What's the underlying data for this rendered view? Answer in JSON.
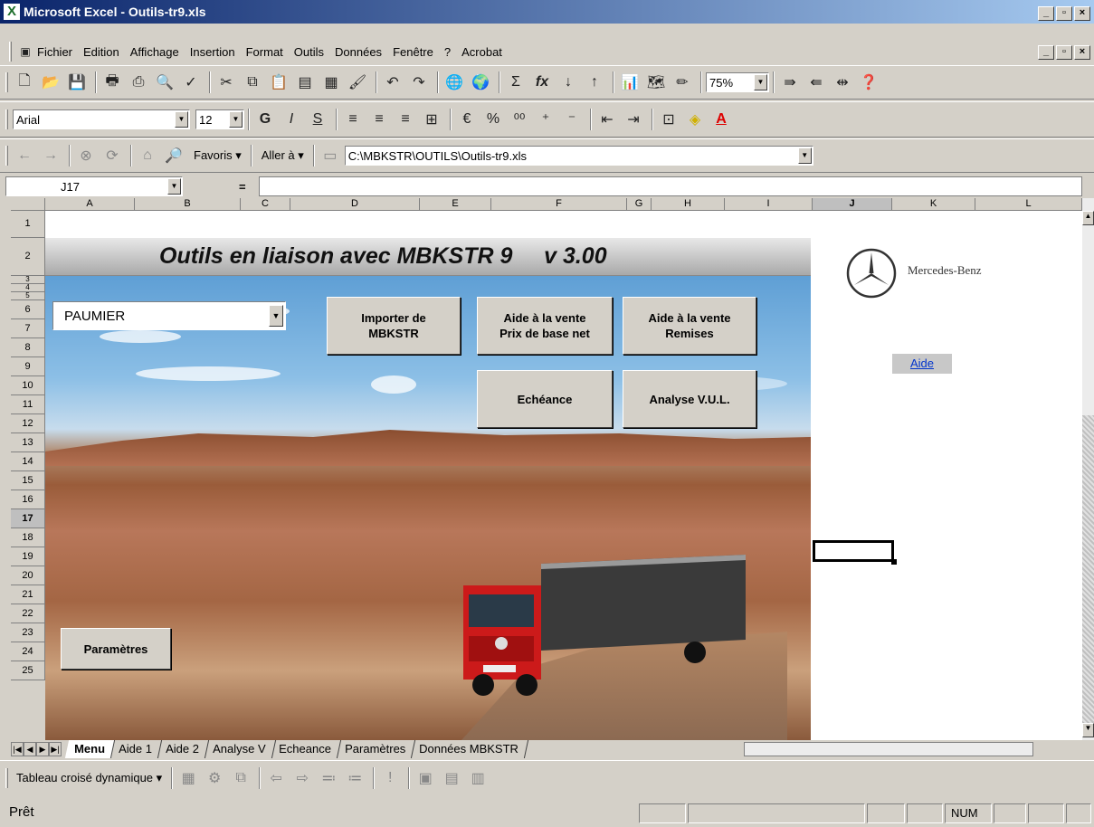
{
  "window": {
    "title": "Microsoft Excel - Outils-tr9.xls"
  },
  "menu": [
    "Fichier",
    "Edition",
    "Affichage",
    "Insertion",
    "Format",
    "Outils",
    "Données",
    "Fenêtre",
    "?",
    "Acrobat"
  ],
  "format_toolbar": {
    "font": "Arial",
    "size": "12",
    "zoom": "75%"
  },
  "web_toolbar": {
    "favoris": "Favoris",
    "aller": "Aller à",
    "address": "C:\\MBKSTR\\OUTILS\\Outils-tr9.xls"
  },
  "formula_bar": {
    "cell_ref": "J17",
    "equals": "="
  },
  "columns": [
    "A",
    "B",
    "C",
    "D",
    "E",
    "F",
    "G",
    "H",
    "I",
    "J",
    "K",
    "L"
  ],
  "rows": [
    "1",
    "2",
    "3",
    "4",
    "5",
    "6",
    "7",
    "8",
    "9",
    "10",
    "11",
    "12",
    "13",
    "14",
    "15",
    "16",
    "17",
    "18",
    "19",
    "20",
    "21",
    "22",
    "23",
    "24",
    "25"
  ],
  "sheet": {
    "banner_title": "Outils en liaison avec MBKSTR 9     v 3.00",
    "dropdown_value": "PAUMIER",
    "btn_importer": "Importer de\nMBKSTR",
    "btn_aide_net": "Aide à la vente\nPrix de base net",
    "btn_aide_remises": "Aide à la vente\nRemises",
    "btn_echeance": "Echéance",
    "btn_analyse": "Analyse V.U.L.",
    "btn_parametres": "Paramètres",
    "brand": "Mercedes-Benz",
    "aide_link": "Aide"
  },
  "tabs": [
    "Menu",
    "Aide 1",
    "Aide 2",
    "Analyse V",
    "Echeance",
    "Paramètres",
    "Données MBKSTR"
  ],
  "pivot_toolbar": {
    "label": "Tableau croisé dynamique"
  },
  "status": {
    "text": "Prêt",
    "num": "NUM"
  },
  "colors": {
    "title_start": "#0a246a",
    "title_end": "#a6caf0",
    "link": "#0033cc"
  }
}
